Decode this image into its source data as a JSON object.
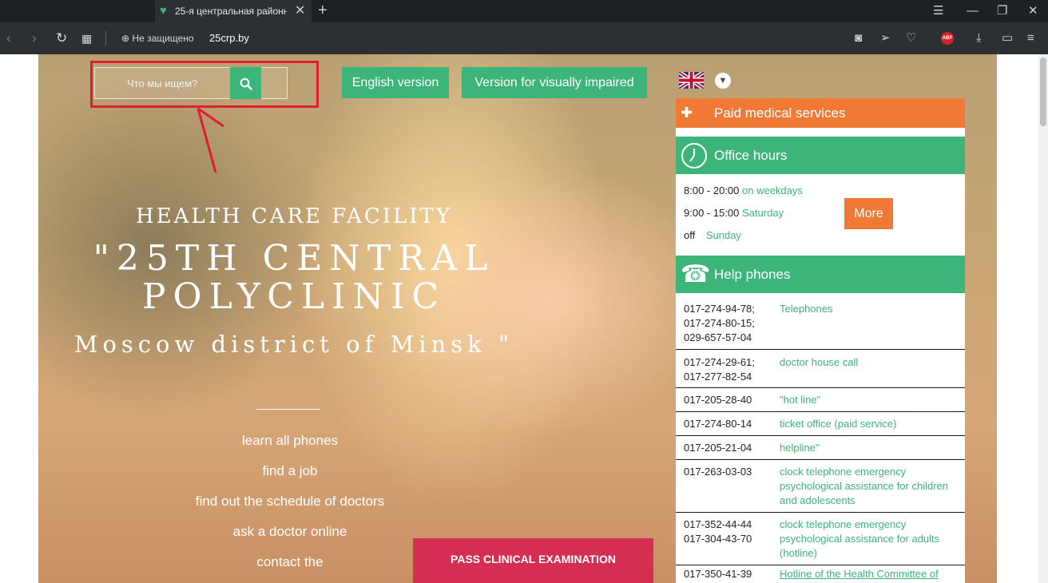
{
  "browser": {
    "tab_title": "25-я центральная районна",
    "new_tab": "+",
    "tab_close": "✕",
    "security": "Не защищено",
    "url": "25crp.by"
  },
  "site": {
    "search_placeholder": "Что мы ищем?",
    "english_version": "English version",
    "visually_impaired": "Version for visually impaired",
    "title_line1": "HEALTH CARE FACILITY",
    "title_line2a": "\"25TH CENTRAL",
    "title_line2b": "POLYCLINIC",
    "title_line3": "Moscow district of Minsk \"",
    "links": [
      "learn all phones",
      "find a job",
      "find out the schedule of doctors",
      "ask a doctor online",
      "contact the"
    ],
    "pass_button": "PASS CLINICAL EXAMINATION"
  },
  "panel": {
    "paid_services": "Paid medical services",
    "office_hours": "Office hours",
    "hours": [
      {
        "time": "8:00 - 20:00",
        "label": "on weekdays"
      },
      {
        "time": "9:00 - 15:00",
        "label": "Saturday"
      },
      {
        "time": "off",
        "label": "Sunday"
      }
    ],
    "more": "More",
    "help_phones": "Help phones",
    "phones": [
      {
        "number": "017-274-94-78;\n017-274-80-15;\n029-657-57-04",
        "label": "Telephones"
      },
      {
        "number": "017-274-29-61;\n017-277-82-54",
        "label": "doctor house call"
      },
      {
        "number": "017-205-28-40",
        "label": "\"hot line\""
      },
      {
        "number": "017-274-80-14",
        "label": "ticket office (paid service)"
      },
      {
        "number": "017-205-21-04",
        "label": "helpline\""
      },
      {
        "number": "017-263-03-03",
        "label": "clock telephone emergency psychological assistance for children and adolescents"
      },
      {
        "number": "017-352-44-44\n017-304-43-70",
        "label": "clock telephone emergency psychological assistance for adults (hotline)"
      },
      {
        "number": "017-350-41-39",
        "label": "Hotline of the Health Committee of"
      }
    ]
  },
  "colors": {
    "green": "#3cb47a",
    "orange": "#f07a35",
    "crimson": "#d62e53",
    "annotation_red": "#e11d2e"
  }
}
